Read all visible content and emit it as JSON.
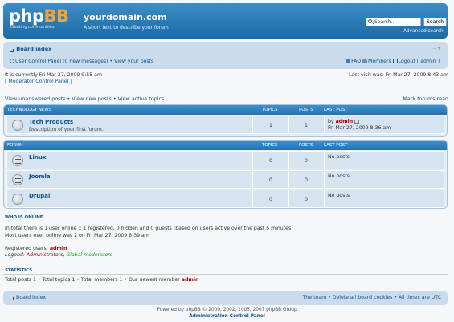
{
  "header": {
    "logo_word_a": "php",
    "logo_word_b": "BB",
    "logo_tagline": "creating communities",
    "site_title": "yourdomain.com",
    "site_description": "A short text to describe your forum",
    "search_placeholder": "Search…",
    "search_button": "Search",
    "advanced_search": "Advanced search"
  },
  "navbar": {
    "board_index": "Board index",
    "font_size": "– + ",
    "ucp": "User Control Panel (0 new messages) • View your posts",
    "faq": "FAQ",
    "members": "Members",
    "logout": "Logout [ admin ]"
  },
  "info": {
    "current_time": "It is currently Fri Mar 27, 2009 9:55 am",
    "mcp": "[ Moderator Control Panel ]",
    "last_visit": "Last visit was: Fri Mar 27, 2009 8:43 am",
    "view_links": "View unanswered posts • View new posts • View active topics",
    "mark_read": "Mark forums read"
  },
  "categories": [
    {
      "header": "Technology News",
      "cols": {
        "topics": "Topics",
        "posts": "Posts",
        "last_post": "Last post"
      },
      "forums": [
        {
          "name": "Tech Products",
          "description": "Description of your first forum.",
          "topics": "1",
          "posts": "1",
          "last_by": "by",
          "last_user": "admin",
          "last_time": "Fri Mar 27, 2009 8:36 am"
        }
      ]
    },
    {
      "header": "Forum",
      "cols": {
        "topics": "Topics",
        "posts": "Posts",
        "last_post": "Last post"
      },
      "forums": [
        {
          "name": "Linux",
          "description": "",
          "topics": "0",
          "posts": "0",
          "last_text": "No posts"
        },
        {
          "name": "Joomla",
          "description": "",
          "topics": "0",
          "posts": "0",
          "last_text": "No posts"
        },
        {
          "name": "Drupal",
          "description": "",
          "topics": "0",
          "posts": "0",
          "last_text": "No posts"
        }
      ]
    }
  ],
  "who_is_online": {
    "title": "Who is online",
    "line1": "In total there is 1 user online :: 1 registered, 0 hidden and 0 guests (based on users active over the past 5 minutes)",
    "line2": "Most users ever online was 2 on Fri Mar 27, 2009 8:39 am",
    "registered_label": "Registered users:",
    "registered_user": "admin",
    "legend_label": "Legend:",
    "legend_admin": "Administrators",
    "legend_mod": "Global moderators"
  },
  "statistics": {
    "title": "Statistics",
    "text": "Total posts 1 • Total topics 1 • Total members 1 • Our newest member",
    "newest": "admin"
  },
  "footer": {
    "board_index": "Board index",
    "right": "The team • Delete all board cookies • All times are UTC",
    "copyright": "Powered by phpBB © 2000, 2002, 2005, 2007 phpBB Group",
    "acp": "Administration Control Panel"
  },
  "colors": {
    "header": "#1a6aa6",
    "navbar": "#cadceb",
    "link": "#105289",
    "admin": "#aa0000",
    "moderator": "#00aa00"
  }
}
